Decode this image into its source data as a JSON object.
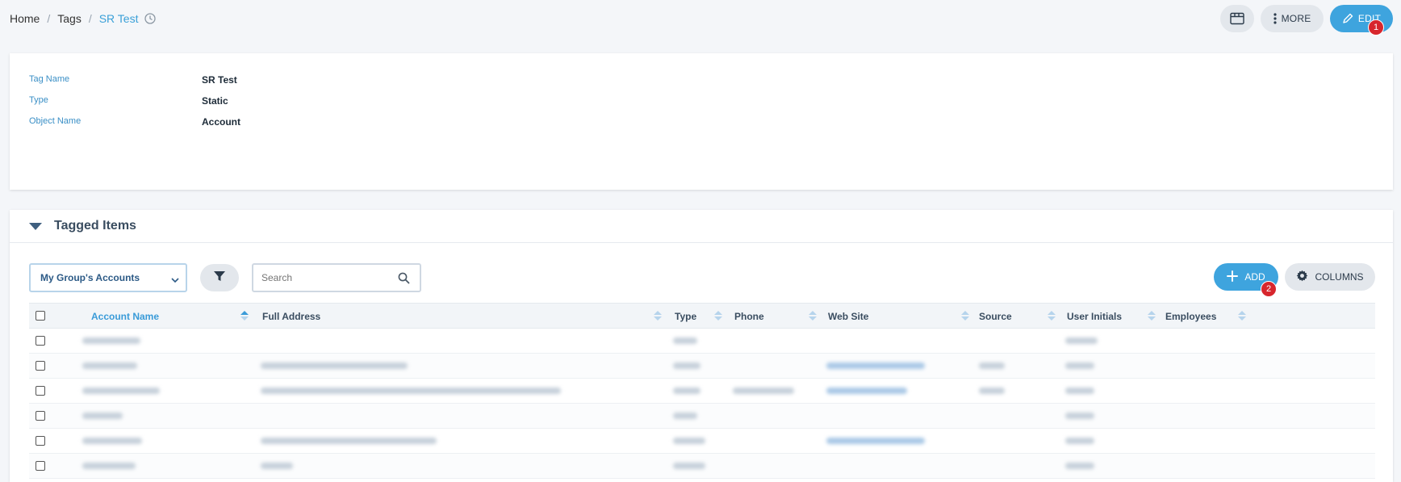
{
  "breadcrumb": {
    "home": "Home",
    "tags": "Tags",
    "current": "SR Test"
  },
  "top_actions": {
    "more_label": "MORE",
    "edit_label": "EDIT",
    "edit_badge": "1"
  },
  "details": {
    "fields": [
      {
        "label": "Tag Name",
        "value": "SR Test"
      },
      {
        "label": "Type",
        "value": "Static"
      },
      {
        "label": "Object Name",
        "value": "Account"
      }
    ]
  },
  "tagged_items": {
    "title": "Tagged Items",
    "view_select": "My Group's Accounts",
    "search_placeholder": "Search",
    "add_label": "ADD",
    "add_badge": "2",
    "columns_label": "COLUMNS",
    "columns": [
      "Account Name",
      "Full Address",
      "Type",
      "Phone",
      "Web Site",
      "Source",
      "User Initials",
      "Employees"
    ],
    "sorted_column": "Account Name",
    "row_count": 6
  },
  "colors": {
    "accent": "#3ea4de",
    "badge": "#d7262d",
    "link": "#3a9bd8"
  },
  "icons": [
    "clock-icon",
    "panel-icon",
    "more-dots-icon",
    "pencil-icon",
    "caret-down-icon",
    "chevron-down-icon",
    "filter-icon",
    "search-icon",
    "plus-icon",
    "gear-icon"
  ]
}
